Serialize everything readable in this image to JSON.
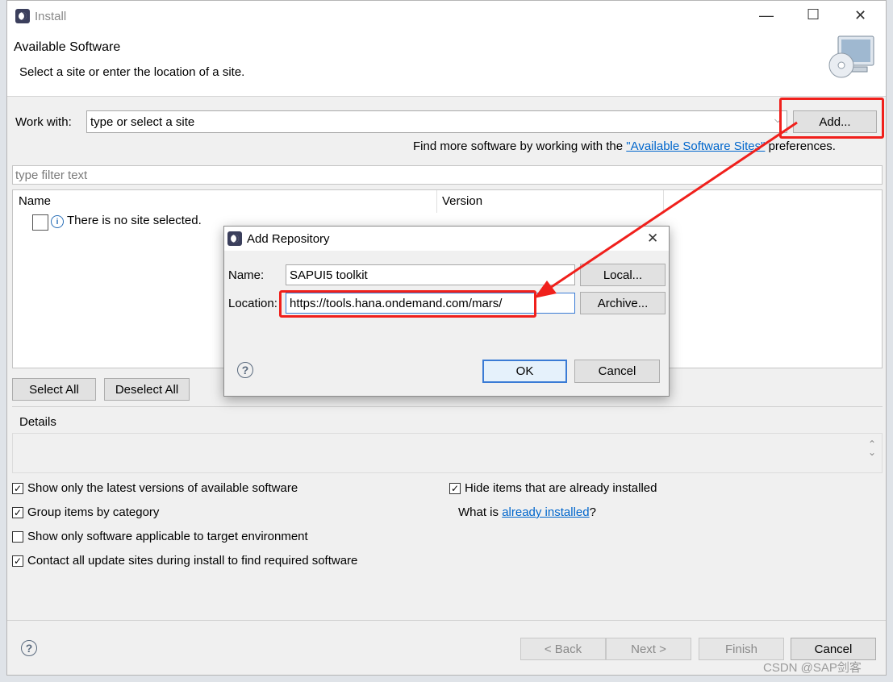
{
  "window": {
    "title": "Install",
    "minimize": "—",
    "maximize": "☐",
    "close": "✕"
  },
  "banner": {
    "title": "Available Software",
    "subtitle": "Select a site or enter the location of a site."
  },
  "work_with": {
    "label": "Work with:",
    "value": "type or select a site",
    "add_button": "Add..."
  },
  "find_more": {
    "prefix": "Find more software by working with the ",
    "link": "\"Available Software Sites\"",
    "suffix": " preferences."
  },
  "filter": {
    "placeholder": "type filter text"
  },
  "table": {
    "columns": [
      "Name",
      "Version"
    ],
    "message": "There is no site selected."
  },
  "selection_buttons": {
    "select_all": "Select All",
    "deselect_all": "Deselect All"
  },
  "details": {
    "label": "Details"
  },
  "options": [
    {
      "label": "Show only the latest versions of available software",
      "checked": true
    },
    {
      "label": "Group items by category",
      "checked": true
    },
    {
      "label": "Show only software applicable to target environment",
      "checked": false
    },
    {
      "label": "Contact all update sites during install to find required software",
      "checked": true
    },
    {
      "label": "Hide items that are already installed",
      "checked": true
    }
  ],
  "installed": {
    "prefix": "What is ",
    "link": "already installed",
    "suffix": "?"
  },
  "footer": {
    "back": "< Back",
    "next": "Next >",
    "finish": "Finish",
    "cancel": "Cancel"
  },
  "dialog": {
    "title": "Add Repository",
    "close": "✕",
    "name_label": "Name:",
    "name_value": "SAPUI5 toolkit",
    "location_label": "Location:",
    "location_value": "https://tools.hana.ondemand.com/mars/",
    "local_button": "Local...",
    "archive_button": "Archive...",
    "ok": "OK",
    "cancel": "Cancel"
  },
  "watermark": "CSDN @SAP剑客",
  "colors": {
    "annotation_red": "#f0201c",
    "link_blue": "#0066cc"
  }
}
